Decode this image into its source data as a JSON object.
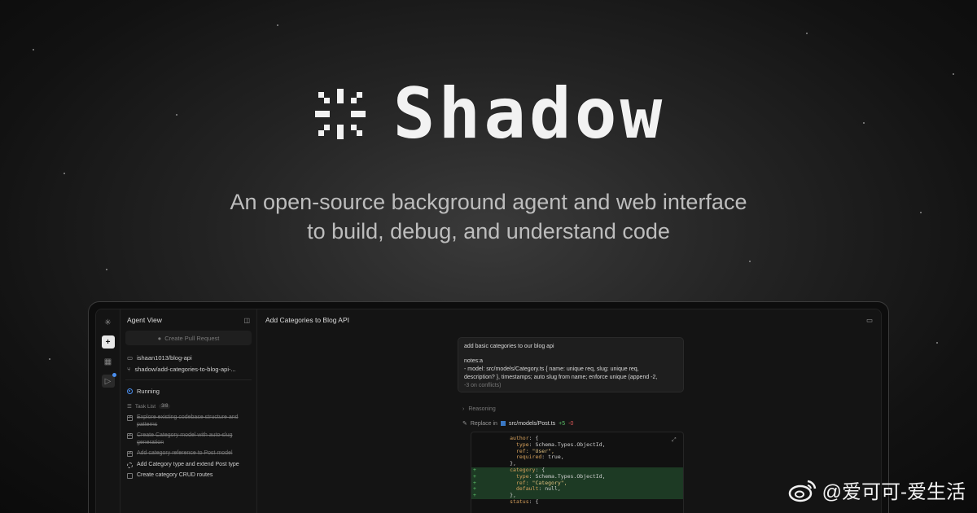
{
  "hero": {
    "brand": "Shadow",
    "tagline_line1": "An open-source background agent and web interface",
    "tagline_line2": "to build, debug, and understand code"
  },
  "sidebar": {
    "title": "Agent View",
    "pr_button": "Create Pull Request",
    "repo": "ishaan1013/blog-api",
    "branch": "shadow/add-categories-to-blog-api-...",
    "status": "Running",
    "task_list_label": "Task List",
    "task_count": "3/8",
    "tasks": [
      {
        "label": "Explore existing codebase structure and patterns",
        "done": true
      },
      {
        "label": "Create Category model with auto-slug generation",
        "done": true
      },
      {
        "label": "Add category reference to Post model",
        "done": true
      },
      {
        "label": "Add Category type and extend Post type",
        "done": false
      },
      {
        "label": "Create category CRUD routes",
        "done": false
      }
    ]
  },
  "main": {
    "title": "Add Categories to Blog API",
    "prompt_line1": "add basic categories to our blog api",
    "prompt_line2": "notes:a",
    "prompt_line3": "- model: src/models/Category.ts { name: unique req, slug: unique req,",
    "prompt_line4": "description? }, timestamps; auto slug from name; enforce unique (append -2,",
    "prompt_line5": "-3 on conflicts)",
    "reasoning": "Reasoning",
    "replace_label": "Replace in",
    "replace_path": "src/models/Post.ts",
    "replace_add": "+5",
    "replace_del": "-0"
  },
  "code_lines": [
    {
      "sign": "",
      "k": "author",
      "rest": ": {",
      "plus": false
    },
    {
      "sign": "",
      "k": "  type",
      "rest": ": Schema.Types.ObjectId,",
      "plus": false
    },
    {
      "sign": "",
      "k": "  ref",
      "rest": ": \"User\",",
      "plus": false
    },
    {
      "sign": "",
      "k": "  required",
      "rest": ": true,",
      "plus": false
    },
    {
      "sign": "",
      "k": "",
      "rest": "},",
      "plus": false
    },
    {
      "sign": "+",
      "k": "category",
      "rest": ": {",
      "plus": true
    },
    {
      "sign": "+",
      "k": "  type",
      "rest": ": Schema.Types.ObjectId,",
      "plus": true
    },
    {
      "sign": "+",
      "k": "  ref",
      "rest": ": \"Category\",",
      "plus": true
    },
    {
      "sign": "+",
      "k": "  default",
      "rest": ": null,",
      "plus": true
    },
    {
      "sign": "+",
      "k": "",
      "rest": "},",
      "plus": true
    },
    {
      "sign": "",
      "k": "status",
      "rest": ": {",
      "plus": false
    }
  ],
  "watermark": "@爱可可-爱生活",
  "colors": {
    "accent": "#4a8ff0",
    "added": "#5cc26a",
    "removed": "#e05858"
  }
}
